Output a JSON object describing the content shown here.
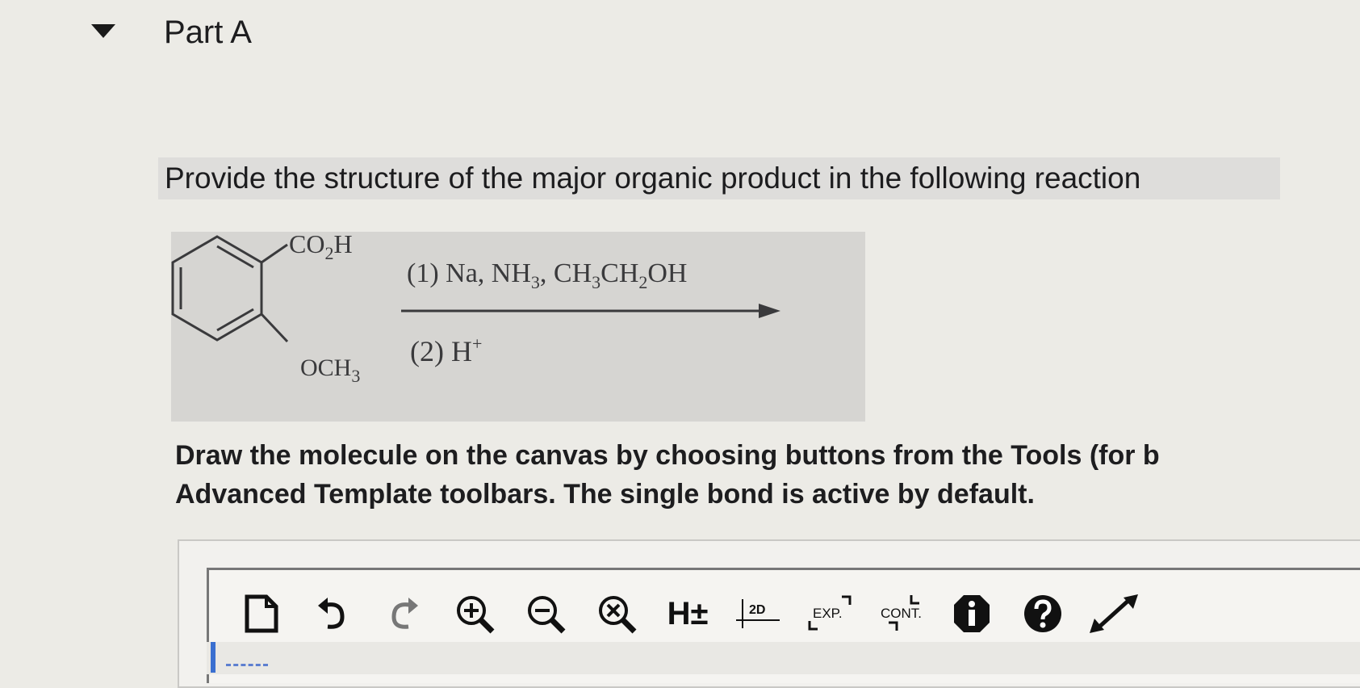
{
  "part": {
    "title": "Part A"
  },
  "question": {
    "text": "Provide the structure of the major organic product in the following reaction"
  },
  "reaction": {
    "substituent_top": "CO",
    "substituent_top_sub": "2",
    "substituent_top_end": "H",
    "substituent_bottom": "OCH",
    "substituent_bottom_sub": "3",
    "step1_prefix": "(1) Na, NH",
    "step1_sub1": "3",
    "step1_mid": ", CH",
    "step1_sub2": "3",
    "step1_mid2": "CH",
    "step1_sub3": "2",
    "step1_end": "OH",
    "step2": "(2) H",
    "step2_sup": "+"
  },
  "instructions": {
    "line1": "Draw the molecule on the canvas by choosing buttons from the Tools (for b",
    "line2": "Advanced Template toolbars. The single bond is active by default."
  },
  "toolbar": {
    "hydrogen_label": "H±",
    "twod_label": "2D",
    "exp_label": "EXP.",
    "cont_label": "CONT."
  }
}
